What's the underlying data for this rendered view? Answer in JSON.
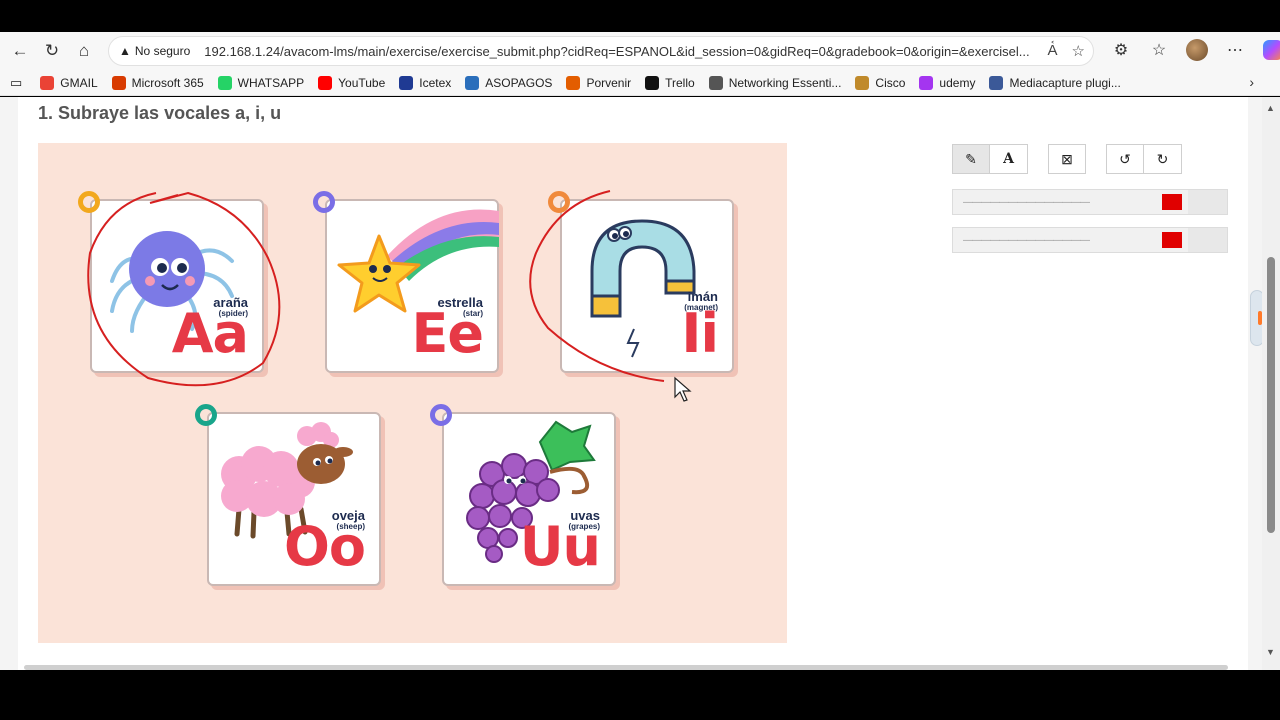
{
  "browser": {
    "security_icon": "warning-triangle-icon",
    "security_label": "No seguro",
    "url": "192.168.1.24/avacom-lms/main/exercise/exercise_submit.php?cidReq=ESPANOL&id_session=0&gidReq=0&gradebook=0&origin=&exercisel..."
  },
  "bookmarks": [
    {
      "label": "GMAIL",
      "color": "#ea4335"
    },
    {
      "label": "Microsoft 365",
      "color": "#d83b01"
    },
    {
      "label": "WHATSAPP",
      "color": "#25d366"
    },
    {
      "label": "YouTube",
      "color": "#ff0000"
    },
    {
      "label": "Icetex",
      "color": "#1f3a93"
    },
    {
      "label": "ASOPAGOS",
      "color": "#2a6ebb"
    },
    {
      "label": "Porvenir",
      "color": "#e35d00"
    },
    {
      "label": "Trello",
      "color": "#111111"
    },
    {
      "label": "Networking Essenti...",
      "color": "#555555"
    },
    {
      "label": "Cisco",
      "color": "#c08a2b"
    },
    {
      "label": "udemy",
      "color": "#a435f0"
    },
    {
      "label": "Mediacapture plugi...",
      "color": "#3b5998"
    }
  ],
  "exercise": {
    "title": "1. Subraye las vocales a, i, u",
    "cards": [
      {
        "letters": "Aa",
        "word": "araña",
        "translation": "(spider)",
        "ring_color": "#f2a81d",
        "circled": true
      },
      {
        "letters": "Ee",
        "word": "estrella",
        "translation": "(star)",
        "ring_color": "#7a6ee6",
        "circled": false
      },
      {
        "letters": "Ii",
        "word": "imán",
        "translation": "(magnet)",
        "ring_color": "#f08a3c",
        "circled": true
      },
      {
        "letters": "Oo",
        "word": "oveja",
        "translation": "(sheep)",
        "ring_color": "#19a58b",
        "circled": false
      },
      {
        "letters": "Uu",
        "word": "uvas",
        "translation": "(grapes)",
        "ring_color": "#7a6ee6",
        "circled": false
      }
    ],
    "annotation_color": "#d62020"
  },
  "toolbar": {
    "buttons": [
      {
        "name": "pencil-tool",
        "icon": "pencil-icon",
        "glyph": "✎",
        "active": true
      },
      {
        "name": "text-tool",
        "icon": "text-icon",
        "glyph": "A",
        "active": false
      },
      {
        "name": "clear-tool",
        "icon": "clear-icon",
        "glyph": "⊠",
        "active": false
      },
      {
        "name": "undo-tool",
        "icon": "undo-icon",
        "glyph": "↺",
        "active": false
      },
      {
        "name": "redo-tool",
        "icon": "redo-icon",
        "glyph": "↻",
        "active": false
      }
    ],
    "stroke_color": "#e00000",
    "text_color": "#e00000",
    "line_placeholder": "——————————————"
  }
}
